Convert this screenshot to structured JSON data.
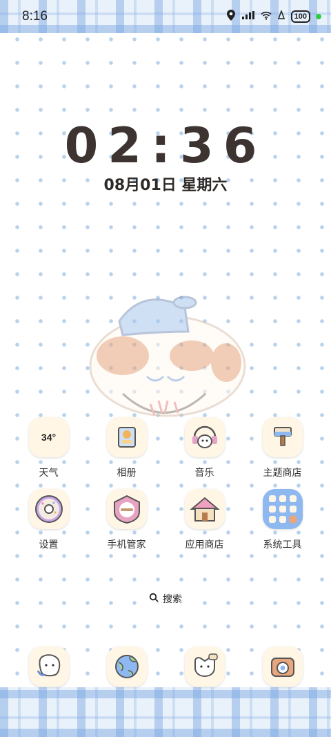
{
  "status_bar": {
    "time": "8:16",
    "battery": "100",
    "icons": [
      "location-icon",
      "signal-icon",
      "wifi-icon",
      "notification-icon",
      "battery-icon"
    ]
  },
  "lock_clock": {
    "time": "02:36",
    "date": "08月01日 星期六"
  },
  "apps": [
    {
      "label": "天气",
      "icon": "weather-icon",
      "text": "34°"
    },
    {
      "label": "相册",
      "icon": "gallery-icon"
    },
    {
      "label": "音乐",
      "icon": "music-icon"
    },
    {
      "label": "主题商店",
      "icon": "theme-store-icon"
    },
    {
      "label": "设置",
      "icon": "settings-icon"
    },
    {
      "label": "手机管家",
      "icon": "phone-manager-icon"
    },
    {
      "label": "应用商店",
      "icon": "app-store-icon"
    },
    {
      "label": "系统工具",
      "icon": "system-tools-folder-icon"
    }
  ],
  "search": {
    "label": "搜索"
  },
  "dock": [
    "phone-icon",
    "browser-icon",
    "messages-icon",
    "camera-icon"
  ],
  "colors": {
    "dot": "#b8d2ec",
    "plaid": "#78a5e1",
    "icon_bg": "#fff6e6",
    "clock": "#3d3330"
  }
}
